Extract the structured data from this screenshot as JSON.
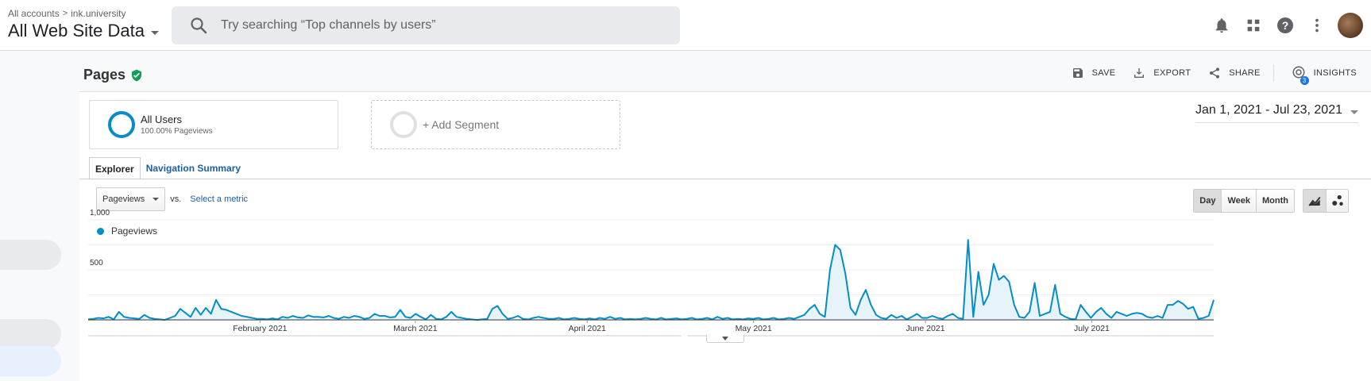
{
  "header": {
    "breadcrumb_account": "All accounts",
    "breadcrumb_property": "ink.university",
    "view_name": "All Web Site Data",
    "search_placeholder": "Try searching “Top channels by users”",
    "icons": [
      "bell-icon",
      "apps-grid-icon",
      "help-icon",
      "more-vert-icon"
    ]
  },
  "page": {
    "title": "Pages",
    "actions": {
      "save": "SAVE",
      "export": "EXPORT",
      "share": "SHARE",
      "insights": "INSIGHTS",
      "insights_count": "3"
    }
  },
  "segments": {
    "active_name": "All Users",
    "active_sub": "100.00% Pageviews",
    "add_label": "+ Add Segment"
  },
  "date_range": "Jan 1, 2021 - Jul 23, 2021",
  "tabs": {
    "explorer": "Explorer",
    "navigation": "Navigation Summary"
  },
  "metric": {
    "selected": "Pageviews",
    "vs": "vs.",
    "select_label": "Select a metric"
  },
  "period": {
    "day": "Day",
    "week": "Week",
    "month": "Month",
    "active": "Day"
  },
  "colors": {
    "series": "#058dc7",
    "fill": "#e6f3f9",
    "link": "#1a5fa6",
    "verified": "#0f9d58"
  },
  "chart_data": {
    "type": "area",
    "legend": "Pageviews",
    "ylim": [
      0,
      1000
    ],
    "y_ticks": [
      "1,000",
      "500"
    ],
    "x_range": [
      "2021-01-01",
      "2021-07-23"
    ],
    "month_labels": [
      {
        "label": "February 2021",
        "date": "2021-02-01"
      },
      {
        "label": "March 2021",
        "date": "2021-03-01"
      },
      {
        "label": "April 2021",
        "date": "2021-04-01"
      },
      {
        "label": "May 2021",
        "date": "2021-05-01"
      },
      {
        "label": "June 2021",
        "date": "2021-06-01"
      },
      {
        "label": "July 2021",
        "date": "2021-07-01"
      }
    ],
    "series": [
      {
        "name": "Pageviews",
        "values": [
          5,
          10,
          20,
          15,
          30,
          5,
          80,
          30,
          20,
          15,
          10,
          50,
          20,
          10,
          5,
          0,
          20,
          40,
          110,
          70,
          30,
          120,
          50,
          120,
          60,
          200,
          110,
          100,
          80,
          60,
          40,
          30,
          20,
          10,
          10,
          5,
          15,
          5,
          30,
          20,
          40,
          25,
          20,
          45,
          30,
          30,
          25,
          40,
          20,
          10,
          30,
          20,
          40,
          30,
          10,
          20,
          60,
          40,
          40,
          25,
          30,
          100,
          30,
          20,
          60,
          30,
          5,
          50,
          10,
          5,
          30,
          80,
          30,
          20,
          10,
          5,
          0,
          5,
          10,
          110,
          140,
          60,
          10,
          20,
          40,
          10,
          5,
          20,
          30,
          20,
          10,
          10,
          20,
          5,
          10,
          20,
          10,
          5,
          15,
          5,
          20,
          10,
          30,
          10,
          20,
          5,
          10,
          5,
          10,
          20,
          10,
          5,
          20,
          5,
          10,
          15,
          5,
          10,
          20,
          5,
          10,
          20,
          5,
          30,
          10,
          20,
          5,
          10,
          5,
          15,
          10,
          20,
          5,
          10,
          20,
          5,
          10,
          20,
          10,
          30,
          50,
          110,
          150,
          60,
          30,
          500,
          750,
          700,
          460,
          120,
          50,
          200,
          300,
          150,
          50,
          20,
          10,
          50,
          20,
          40,
          5,
          30,
          60,
          20,
          20,
          40,
          20,
          10,
          40,
          60,
          20,
          10,
          800,
          30,
          480,
          150,
          250,
          560,
          400,
          440,
          380,
          150,
          30,
          20,
          80,
          370,
          40,
          60,
          80,
          350,
          60,
          30,
          10,
          5,
          150,
          80,
          20,
          80,
          120,
          60,
          20,
          80,
          60,
          40,
          60,
          70,
          60,
          30,
          20,
          40,
          20,
          150,
          150,
          190,
          160,
          110,
          130,
          10,
          20,
          40,
          200
        ]
      }
    ]
  }
}
